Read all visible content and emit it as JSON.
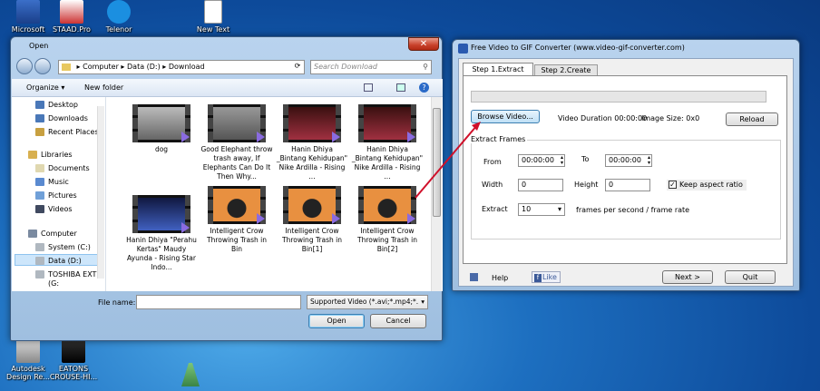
{
  "desktop_icons": [
    {
      "label": "Microsoft",
      "icon": "office-icon"
    },
    {
      "label": "STAAD.Pro",
      "icon": "staad-icon"
    },
    {
      "label": "Telenor",
      "icon": "telenor-icon"
    },
    {
      "label": "New Text",
      "icon": "text-file-icon"
    },
    {
      "label": "Autodesk Design Re...",
      "icon": "autodesk-icon"
    },
    {
      "label": "EATONS CROUSE-HI...",
      "icon": "eatons-icon"
    }
  ],
  "open_dialog": {
    "title": "Open",
    "breadcrumb": [
      "Computer",
      "Data (D:)",
      "Download"
    ],
    "search_placeholder": "Search Download",
    "toolbar": {
      "organize": "Organize ▾",
      "new_folder": "New folder"
    },
    "nav": {
      "favorites": [
        "Desktop",
        "Downloads",
        "Recent Places"
      ],
      "libraries_label": "Libraries",
      "libraries": [
        "Documents",
        "Music",
        "Pictures",
        "Videos"
      ],
      "computer_label": "Computer",
      "drives": [
        "System (C:)",
        "Data (D:)",
        "TOSHIBA EXT (G:"
      ]
    },
    "files": [
      {
        "name": "dog"
      },
      {
        "name": "Good Elephant throw trash away, If Elephants Can Do It Then Why..."
      },
      {
        "name": "Hanin Dhiya _Bintang Kehidupan\" Nike Ardilla - Rising ..."
      },
      {
        "name": "Hanin Dhiya _Bintang Kehidupan\" Nike Ardilla - Rising ..."
      },
      {
        "name": "Hanin Dhiya \"Perahu Kertas\" Maudy Ayunda - Rising Star Indo..."
      },
      {
        "name": "Intelligent Crow Throwing Trash in Bin"
      },
      {
        "name": "Intelligent Crow Throwing Trash in Bin[1]"
      },
      {
        "name": "Intelligent Crow Throwing Trash in Bin[2]"
      }
    ],
    "filename_label": "File name:",
    "filename_value": "",
    "filetype_value": "Supported Video (*.avi;*.mp4;*.",
    "open_label": "Open",
    "cancel_label": "Cancel"
  },
  "converter": {
    "title": "Free Video to GIF Converter (www.video-gif-converter.com)",
    "tabs": [
      "Step 1.Extract Video",
      "Step 2.Create GIF"
    ],
    "browse_label": "Browse Video...",
    "video_duration": "Video Duration 00:00:00",
    "image_size": "Image Size: 0x0",
    "reload_label": "Reload",
    "extract_frames_label": "Extract Frames",
    "from_label": "From",
    "from_value": "00:00:00",
    "to_label": "To",
    "to_value": "00:00:00",
    "width_label": "Width",
    "width_value": "0",
    "height_label": "Height",
    "height_value": "0",
    "keep_aspect_label": "Keep aspect ratio",
    "keep_aspect_checked": true,
    "extract_label": "Extract",
    "extract_value": "10",
    "fps_label": "frames per second / frame rate",
    "help_label": "Help",
    "like_label": "Like",
    "next_label": "Next >",
    "quit_label": "Quit"
  }
}
